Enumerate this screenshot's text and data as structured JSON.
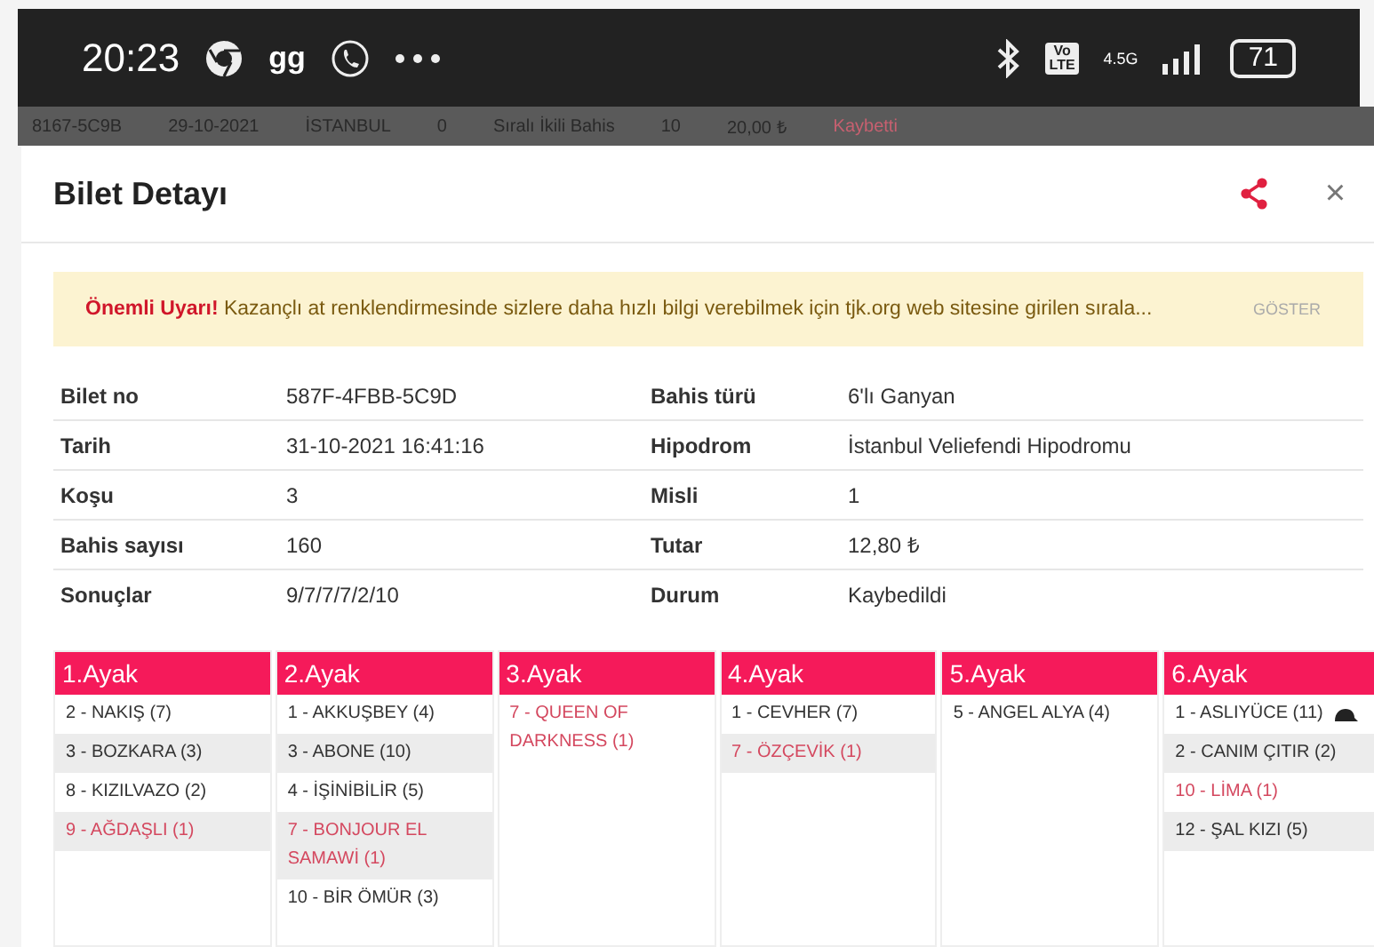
{
  "status_bar": {
    "time": "20:23",
    "app_label": "gg",
    "network_badge": [
      "Vo",
      "LTE"
    ],
    "network_type": "4.5G",
    "battery": "71"
  },
  "background_row": {
    "cells": [
      "8167-5C9B",
      "29-10-2021",
      "İSTANBUL",
      "0",
      "Sıralı İkili Bahis",
      "10",
      "20,00 ₺"
    ],
    "status": "Kaybetti"
  },
  "dialog": {
    "title": "Bilet Detayı",
    "close": "×",
    "warning": {
      "label": "Önemli Uyarı!",
      "text": "Kazançlı at renklendirmesinde sizlere daha hızlı bilgi verebilmek için tjk.org web sitesine girilen sırala...",
      "action": "GÖSTER"
    },
    "details": [
      {
        "label": "Bilet no",
        "value": "587F-4FBB-5C9D",
        "label_2": "Bahis türü",
        "value_2": "6'lı Ganyan"
      },
      {
        "label": "Tarih",
        "value": "31-10-2021 16:41:16",
        "label_2": "Hipodrom",
        "value_2": "İstanbul Veliefendi Hipodromu"
      },
      {
        "label": "Koşu",
        "value": "3",
        "label_2": "Misli",
        "value_2": "1"
      },
      {
        "label": "Bahis sayısı",
        "value": "160",
        "label_2": "Tutar",
        "value_2": "12,80 ₺"
      },
      {
        "label": "Sonuçlar",
        "value": "9/7/7/7/2/10",
        "label_2": "Durum",
        "value_2": "Kaybedildi"
      }
    ],
    "legs": [
      {
        "title": "1.Ayak",
        "horses": [
          {
            "name": "2 - NAKIŞ (7)",
            "winner": false,
            "cap": false
          },
          {
            "name": "3 - BOZKARA (3)",
            "winner": false,
            "cap": false
          },
          {
            "name": "8 - KIZILVAZO (2)",
            "winner": false,
            "cap": false
          },
          {
            "name": "9 - AĞDAŞLI (1)",
            "winner": true,
            "cap": false
          }
        ]
      },
      {
        "title": "2.Ayak",
        "horses": [
          {
            "name": "1 - AKKUŞBEY (4)",
            "winner": false,
            "cap": false
          },
          {
            "name": "3 - ABONE (10)",
            "winner": false,
            "cap": false
          },
          {
            "name": "4 - İŞİNİBİLİR (5)",
            "winner": false,
            "cap": false
          },
          {
            "name": "7 - BONJOUR EL SAMAWİ (1)",
            "winner": true,
            "cap": false
          },
          {
            "name": "10 - BİR ÖMÜR (3)",
            "winner": false,
            "cap": false
          }
        ]
      },
      {
        "title": "3.Ayak",
        "horses": [
          {
            "name": "7 - QUEEN OF DARKNESS (1)",
            "winner": true,
            "cap": false
          }
        ]
      },
      {
        "title": "4.Ayak",
        "horses": [
          {
            "name": "1 - CEVHER (7)",
            "winner": false,
            "cap": false
          },
          {
            "name": "7 - ÖZÇEVİK (1)",
            "winner": true,
            "cap": false
          }
        ]
      },
      {
        "title": "5.Ayak",
        "horses": [
          {
            "name": "5 - ANGEL ALYA (4)",
            "winner": false,
            "cap": false
          }
        ]
      },
      {
        "title": "6.Ayak",
        "horses": [
          {
            "name": "1 - ASLIYÜCE (11)",
            "winner": false,
            "cap": true
          },
          {
            "name": "2 - CANIM ÇITIR (2)",
            "winner": false,
            "cap": false
          },
          {
            "name": "10 - LİMA (1)",
            "winner": true,
            "cap": false
          },
          {
            "name": "12 - ŞAL KIZI (5)",
            "winner": false,
            "cap": false
          }
        ]
      }
    ]
  }
}
